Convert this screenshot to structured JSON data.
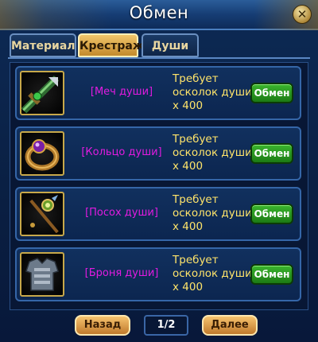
{
  "window": {
    "title": "Обмен",
    "close_icon": "close-x-icon"
  },
  "tabs": [
    {
      "label": "Материал",
      "active": false
    },
    {
      "label": "Крестраж",
      "active": true
    },
    {
      "label": "Души",
      "active": false
    }
  ],
  "items": [
    {
      "name": "[Меч души]",
      "icon": "sword-icon",
      "req_line1": "Требует",
      "req_line2": "осколок души",
      "req_line3": "x 400",
      "button": "Обмен"
    },
    {
      "name": "[Кольцо души]",
      "icon": "ring-icon",
      "req_line1": "Требует",
      "req_line2": "осколок души",
      "req_line3": "x 400",
      "button": "Обмен"
    },
    {
      "name": "[Посох души]",
      "icon": "staff-icon",
      "req_line1": "Требует",
      "req_line2": "осколок души",
      "req_line3": "x 400",
      "button": "Обмен"
    },
    {
      "name": "[Броня души]",
      "icon": "armor-icon",
      "req_line1": "Требует",
      "req_line2": "осколок души",
      "req_line3": "x 400",
      "button": "Обмен"
    }
  ],
  "pager": {
    "prev": "Назад",
    "page": "1/2",
    "next": "Далее"
  },
  "colors": {
    "item_name": "#e21be0",
    "requirement": "#ffe46a",
    "swap_button": "#2e9a22"
  }
}
